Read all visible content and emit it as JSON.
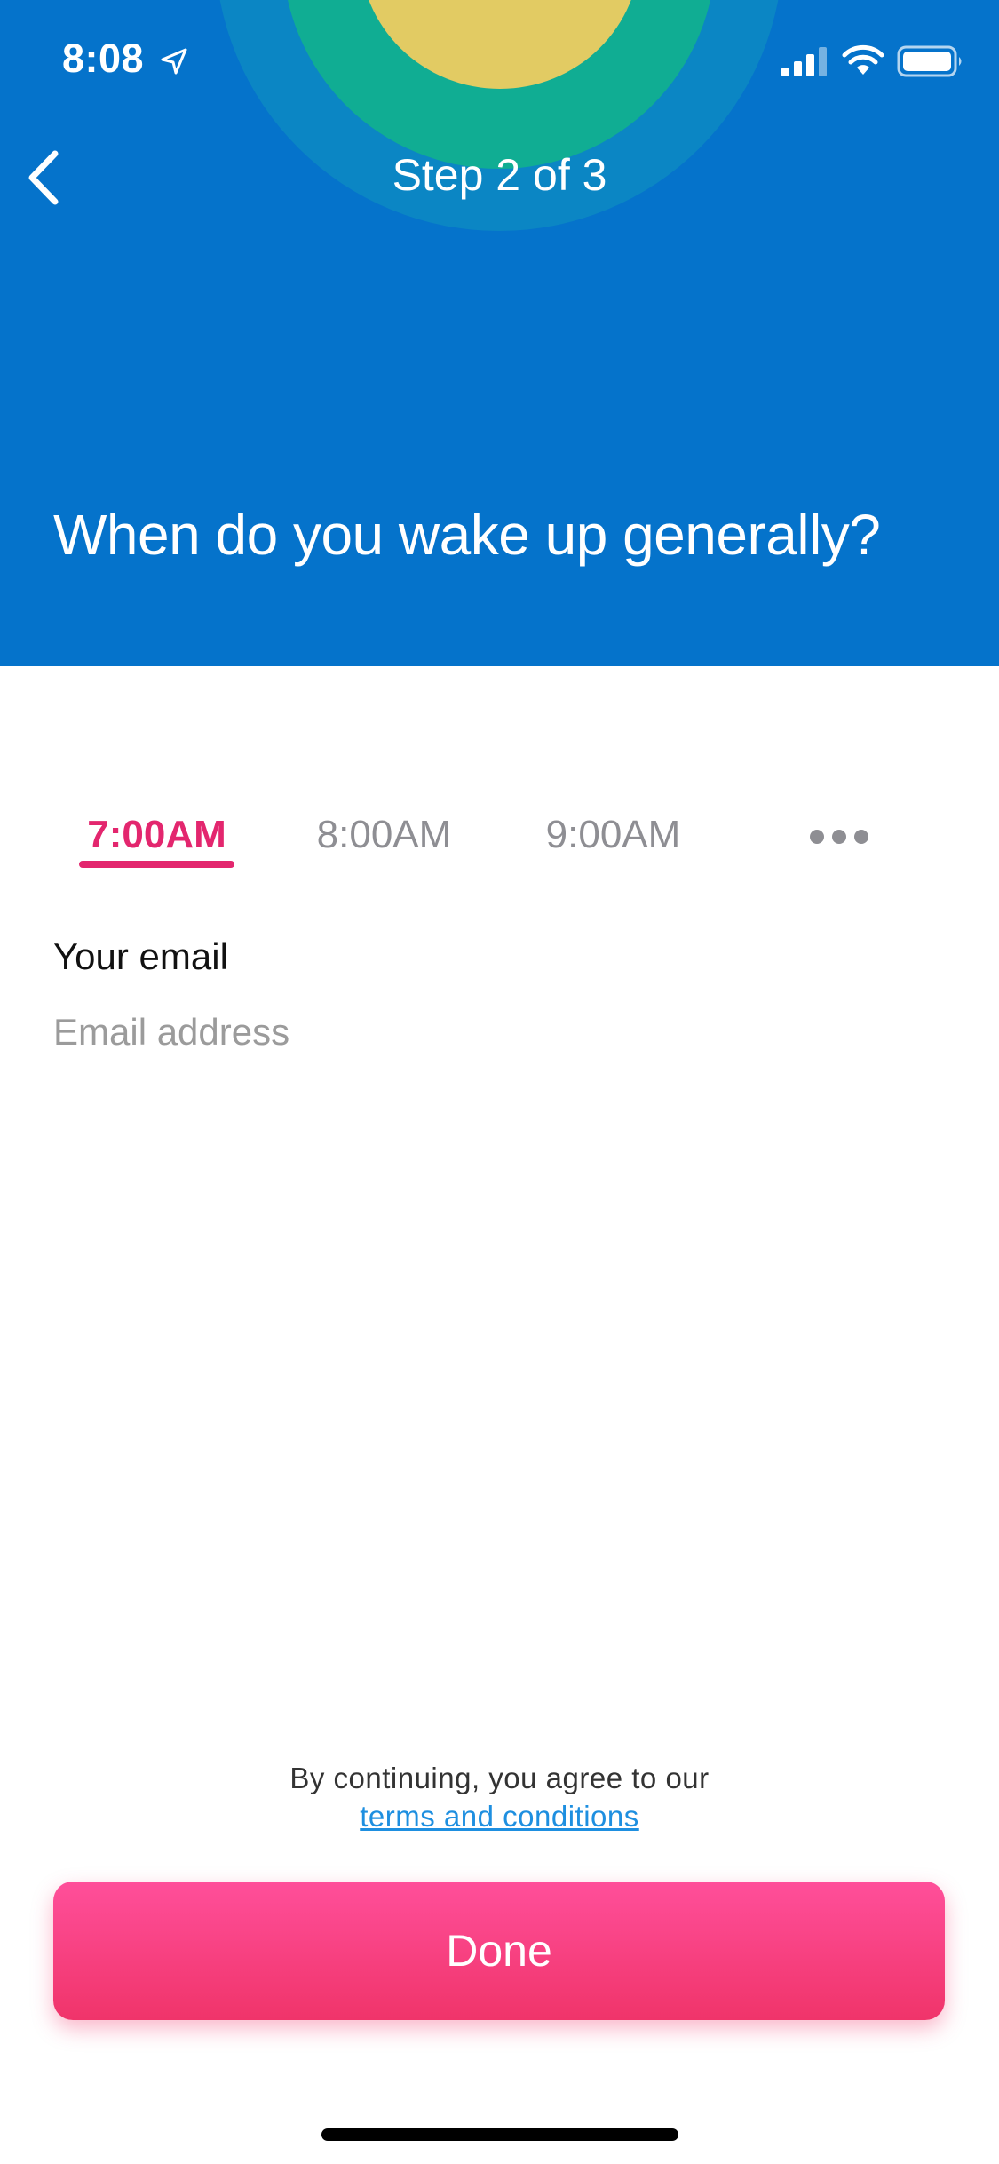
{
  "status_bar": {
    "time": "8:08"
  },
  "header": {
    "step_label": "Step 2 of 3",
    "question": "When do you wake up generally?"
  },
  "time_options": {
    "selected": "7:00AM",
    "items": [
      "7:00AM",
      "8:00AM",
      "9:00AM"
    ]
  },
  "email": {
    "label": "Your email",
    "placeholder": "Email address",
    "value": ""
  },
  "terms": {
    "text": "By continuing, you agree to our",
    "link": "terms and conditions"
  },
  "done_button": {
    "label": "Done"
  },
  "colors": {
    "header_bg": "#0573cb",
    "accent": "#e3266e",
    "button_gradient_top": "#ff4f9a",
    "button_gradient_bottom": "#f0346a",
    "link": "#1e8fe0"
  }
}
